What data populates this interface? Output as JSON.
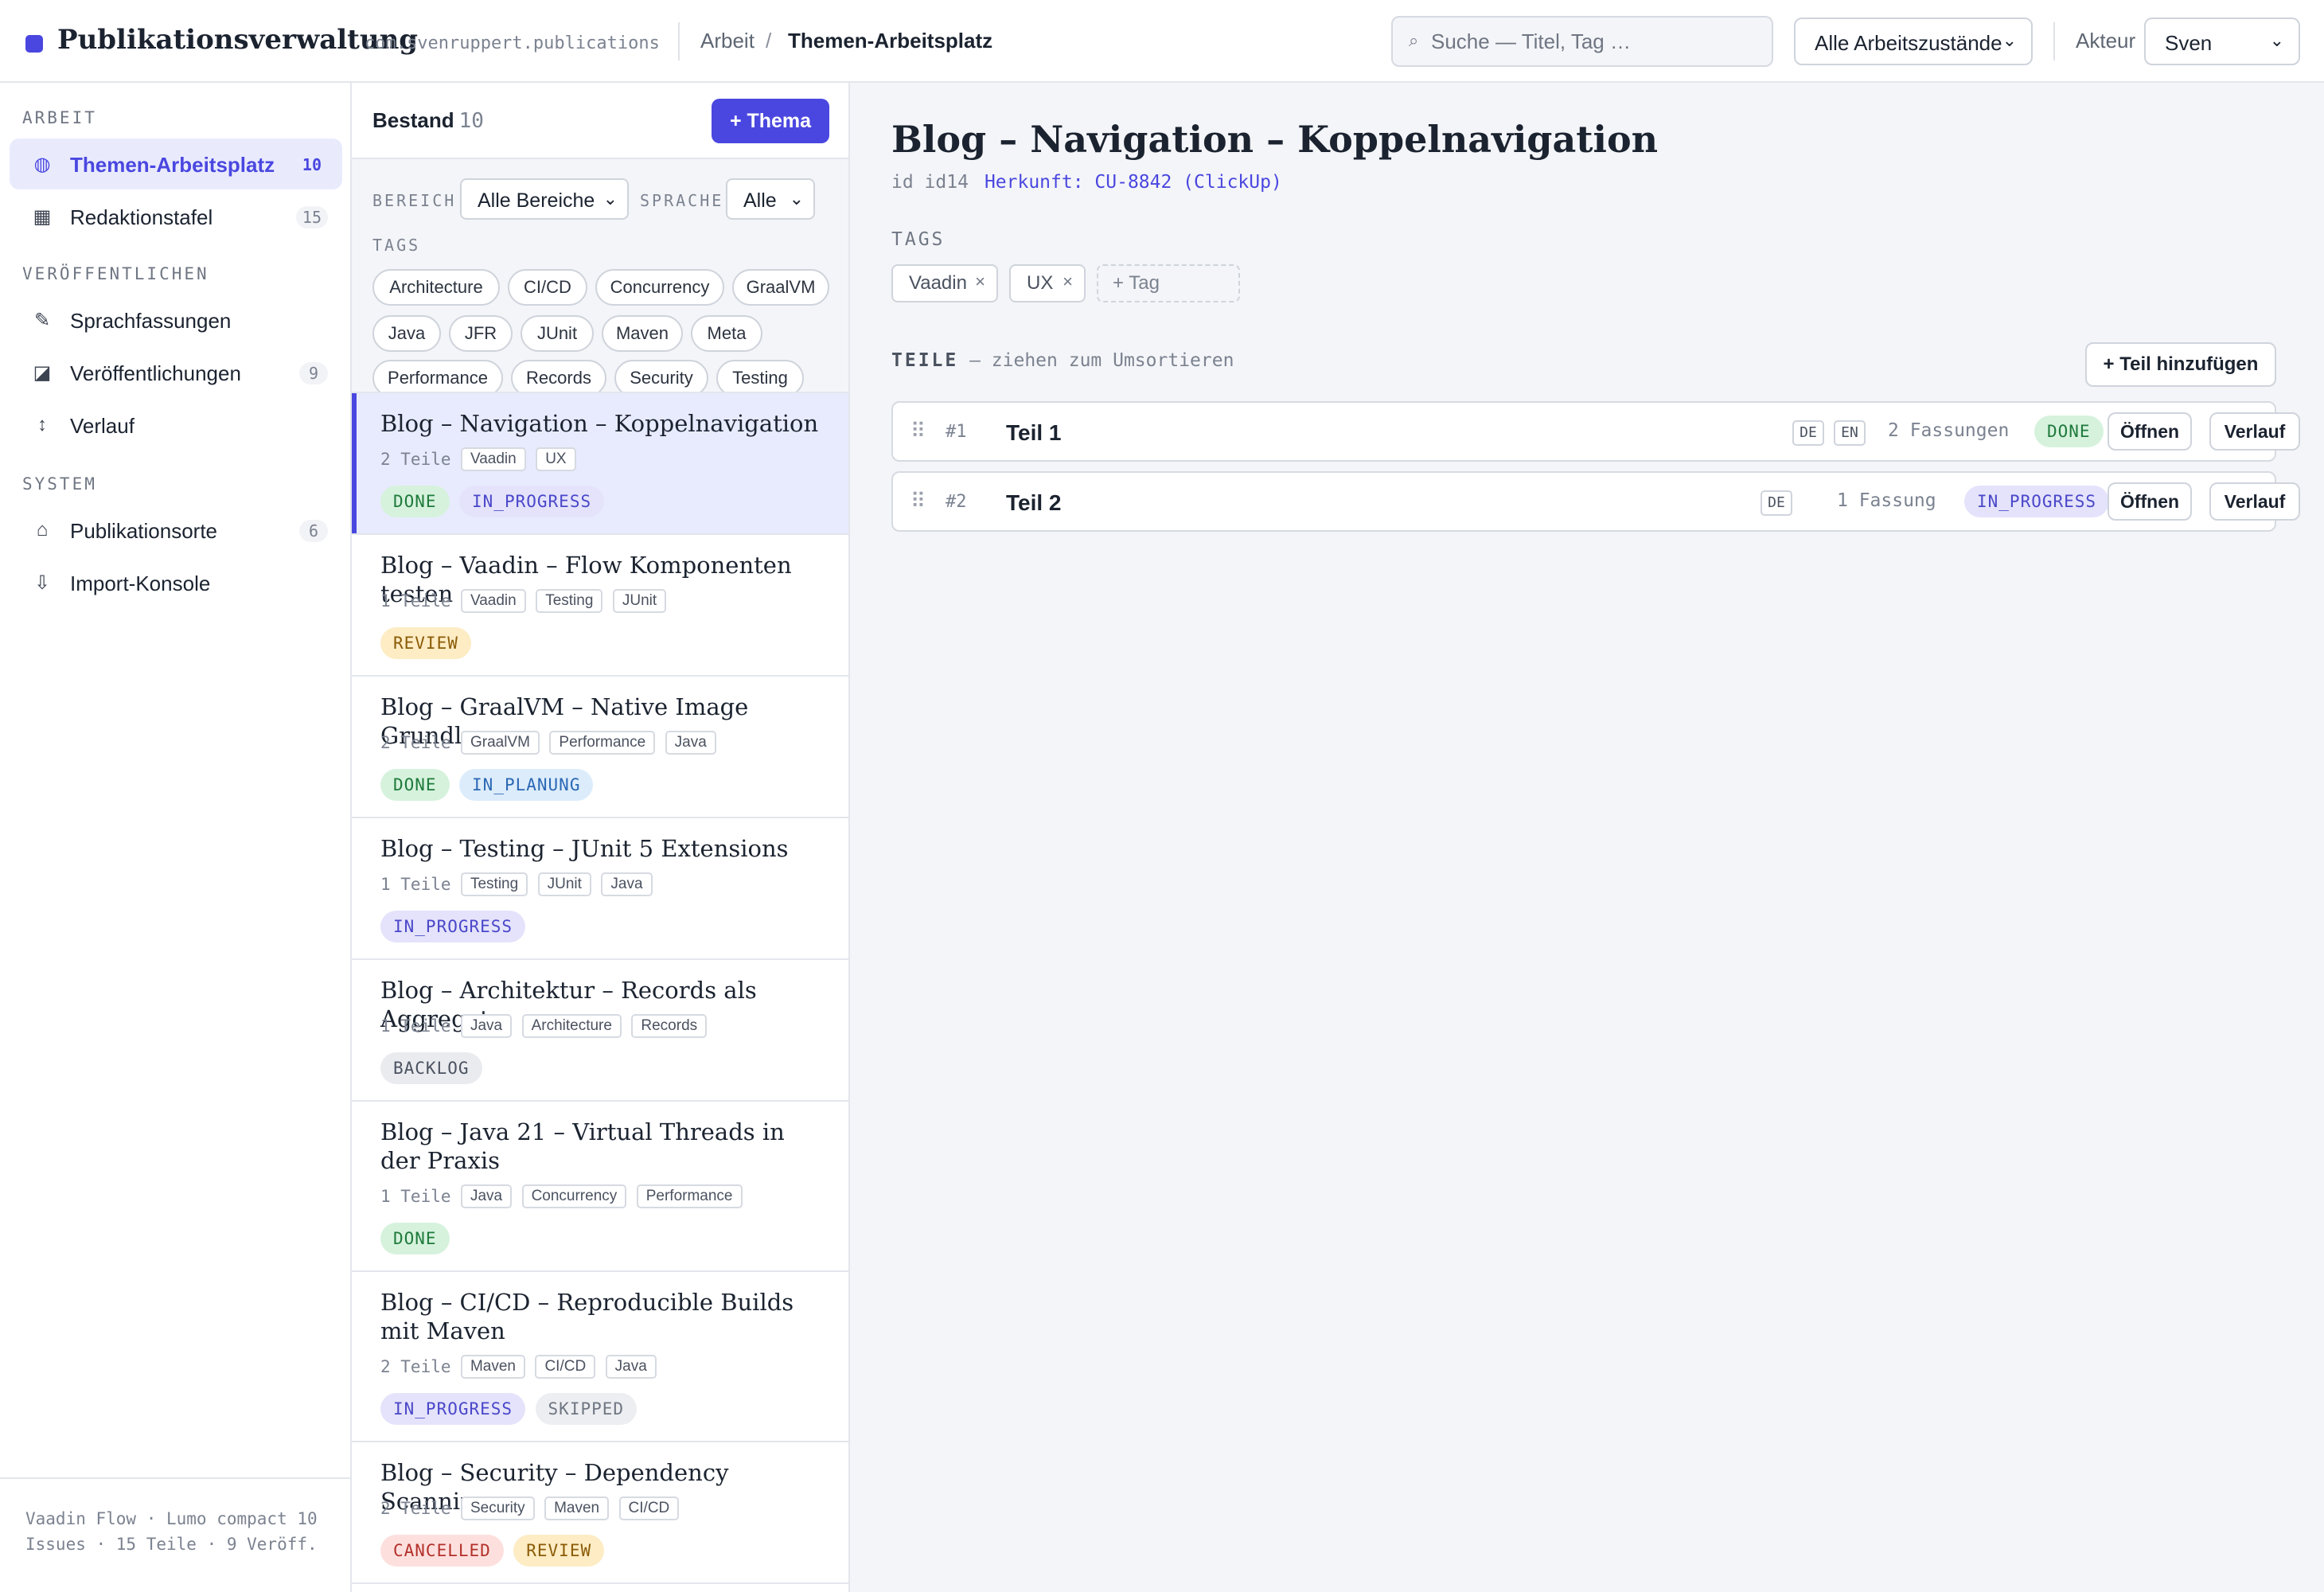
{
  "header": {
    "app_title": "Publikationsverwaltung",
    "package": "com.svenruppert.publications",
    "breadcrumb": [
      "Arbeit",
      "Themen-Arbeitsplatz"
    ],
    "breadcrumb_sep": "/",
    "search_placeholder": "Suche — Titel, Tag …",
    "search_icon": "⌕",
    "state_filter": "Alle Arbeitszustände",
    "actor_label": "Akteur",
    "actor_value": "Sven"
  },
  "sidebar": {
    "sections": [
      "ARBEIT",
      "VERÖFFENTLICHEN",
      "SYSTEM"
    ],
    "items": [
      {
        "label": "Themen-Arbeitsplatz",
        "count": "10",
        "icon": "◍"
      },
      {
        "label": "Redaktionstafel",
        "count": "15",
        "icon": "▦"
      },
      {
        "label": "Sprachfassungen",
        "count": "",
        "icon": "✎"
      },
      {
        "label": "Veröffentlichungen",
        "count": "9",
        "icon": "◪"
      },
      {
        "label": "Verlauf",
        "count": "",
        "icon": "↕"
      },
      {
        "label": "Publikationsorte",
        "count": "6",
        "icon": "⌂"
      },
      {
        "label": "Import-Konsole",
        "count": "",
        "icon": "⇩"
      }
    ],
    "footer": "Vaadin Flow · Lumo compact 10 Issues · 15 Teile · 9 Veröff."
  },
  "list": {
    "title": "Bestand",
    "count": "10",
    "add_label": "+ Thema",
    "filter_area_label": "BEREICH",
    "filter_area_value": "Alle Bereiche",
    "filter_lang_label": "SPRACHE",
    "filter_lang_value": "Alle",
    "tags_label": "TAGS",
    "tag_chips": [
      "Architecture",
      "CI/CD",
      "Concurrency",
      "GraalVM",
      "Java",
      "JFR",
      "JUnit",
      "Maven",
      "Meta",
      "Performance",
      "Records",
      "Security",
      "Testing"
    ],
    "items": [
      {
        "title": "Blog – Navigation – Koppelnavigation",
        "teile": "2 Teile",
        "tags": [
          "Vaadin",
          "UX"
        ],
        "statuses": [
          "DONE",
          "IN_PROGRESS"
        ]
      },
      {
        "title": "Blog – Vaadin – Flow Komponenten testen",
        "teile": "1 Teile",
        "tags": [
          "Vaadin",
          "Testing",
          "JUnit"
        ],
        "statuses": [
          "REVIEW"
        ]
      },
      {
        "title": "Blog – GraalVM – Native Image Grundlagen",
        "teile": "2 Teile",
        "tags": [
          "GraalVM",
          "Performance",
          "Java"
        ],
        "statuses": [
          "DONE",
          "IN_PLANUNG"
        ]
      },
      {
        "title": "Blog – Testing – JUnit 5 Extensions",
        "teile": "1 Teile",
        "tags": [
          "Testing",
          "JUnit",
          "Java"
        ],
        "statuses": [
          "IN_PROGRESS"
        ]
      },
      {
        "title": "Blog – Architektur – Records als Aggregate",
        "teile": "1 Teile",
        "tags": [
          "Java",
          "Architecture",
          "Records"
        ],
        "statuses": [
          "BACKLOG"
        ]
      },
      {
        "title": "Blog – Java 21 – Virtual Threads in der Praxis",
        "teile": "1 Teile",
        "tags": [
          "Java",
          "Concurrency",
          "Performance"
        ],
        "statuses": [
          "DONE"
        ]
      },
      {
        "title": "Blog – CI/CD – Reproducible Builds mit Maven",
        "teile": "2 Teile",
        "tags": [
          "Maven",
          "CI/CD",
          "Java"
        ],
        "statuses": [
          "IN_PROGRESS",
          "SKIPPED"
        ]
      },
      {
        "title": "Blog – Security – Dependency Scanning",
        "teile": "2 Teile",
        "tags": [
          "Security",
          "Maven",
          "CI/CD"
        ],
        "statuses": [
          "CANCELLED",
          "REVIEW"
        ]
      }
    ]
  },
  "detail": {
    "title": "Blog – Navigation – Koppelnavigation",
    "id": "id id14",
    "origin": "Herkunft: CU-8842 (ClickUp)",
    "tags_label": "TAGS",
    "tags": [
      "Vaadin",
      "UX"
    ],
    "tag_remove": "×",
    "tag_add": "+ Tag",
    "parts_label": "TEILE",
    "parts_hint": " — ziehen zum Umsortieren",
    "add_part_label": "+ Teil hinzufügen",
    "open_label": "Öffnen",
    "history_label": "Verlauf",
    "parts": [
      {
        "num": "#1",
        "name": "Teil 1",
        "langs": [
          "DE",
          "EN"
        ],
        "versions": "2 Fassungen",
        "status": "DONE"
      },
      {
        "num": "#2",
        "name": "Teil 2",
        "langs": [
          "DE"
        ],
        "versions": "1 Fassung",
        "status": "IN_PROGRESS"
      }
    ]
  },
  "colors": {
    "accent": "#4a47e0",
    "done": "#1f7a3b",
    "in_progress": "#4a47c9",
    "review": "#8a5b06",
    "in_planung": "#2b68b4",
    "cancelled": "#b3312a"
  }
}
